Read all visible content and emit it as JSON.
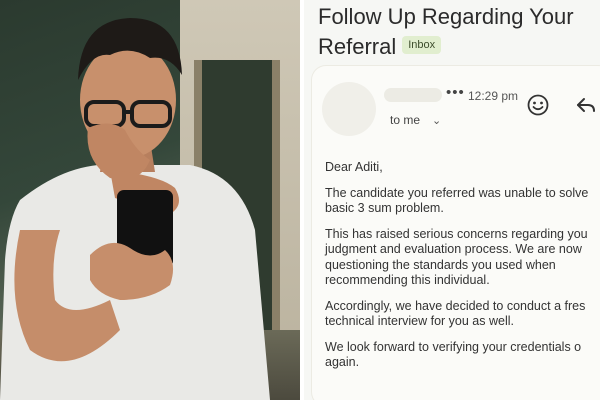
{
  "email": {
    "subject": "Follow Up Regarding Your Referral",
    "label_badge": "Inbox",
    "time": "12:29 pm",
    "recipient": "to me",
    "more_glyph": "•••",
    "chevron_glyph": "⌄",
    "greeting": "Dear Aditi,",
    "paragraphs": [
      "The candidate you referred was unable to solve\nbasic 3 sum problem.",
      "This has raised serious concerns regarding you\njudgment and evaluation process. We are now\nquestioning the standards you used when\nrecommending this individual.",
      "Accordingly, we have decided to conduct a fres\ntechnical interview for you as well.",
      "We look forward to verifying your credentials o\nagain."
    ]
  },
  "colors": {
    "email_background": "#f6f7f4",
    "badge_background": "#e1eecf",
    "text": "#333333"
  },
  "icons": [
    "more-icon",
    "smile-icon",
    "reply-icon",
    "chevron-down-icon"
  ]
}
